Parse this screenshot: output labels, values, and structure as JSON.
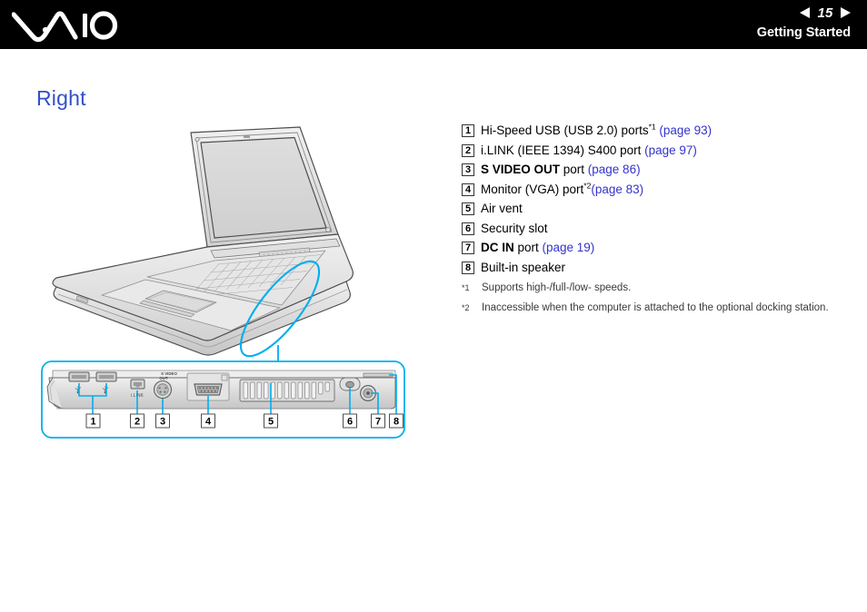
{
  "header": {
    "logo_name": "VAIO",
    "page_number": "15",
    "prev_arrow": "prev-page-arrow",
    "next_arrow": "next-page-arrow",
    "section": "Getting Started"
  },
  "page": {
    "title": "Right"
  },
  "callouts": [
    {
      "num": "1",
      "html": "Hi-Speed USB (USB 2.0) ports<sup>*1</sup> <span class=\"lnk\">(page 93)</span>"
    },
    {
      "num": "2",
      "html": "i.LINK (IEEE 1394) S400 port <span class=\"lnk\">(page 97)</span>"
    },
    {
      "num": "3",
      "html": "<b>S VIDEO OUT</b> port <span class=\"lnk\">(page 86)</span>"
    },
    {
      "num": "4",
      "html": "Monitor (VGA) port<sup>*2</sup><span class=\"lnk\">(page 83)</span>"
    },
    {
      "num": "5",
      "html": "Air vent"
    },
    {
      "num": "6",
      "html": "Security slot"
    },
    {
      "num": "7",
      "html": "<b>DC IN</b> port <span class=\"lnk\">(page 19)</span>"
    },
    {
      "num": "8",
      "html": "Built-in speaker"
    }
  ],
  "footnotes": [
    {
      "mark": "*1",
      "text": "Supports high-/full-/low- speeds."
    },
    {
      "mark": "*2",
      "text": "Inaccessible when the computer is attached to the optional docking station."
    }
  ],
  "diagram": {
    "laptop_label": "laptop-line-art",
    "highlight_label": "right-edge-highlight",
    "detail_panel_label": "right-side-port-detail",
    "detail_callout_numbers": [
      "1",
      "2",
      "3",
      "4",
      "5",
      "6",
      "7",
      "8"
    ],
    "port_marks": {
      "svideo_label": "S VIDEO OUT",
      "usb_symbol": "usb-trident",
      "ilink_symbol": "i.LINK"
    }
  },
  "colors": {
    "accent_blue": "#3250c8",
    "link_blue": "#3333cc",
    "highlight_cyan": "#00AEEF",
    "header_bg": "#000000",
    "line_art": "#4d4d4d"
  }
}
